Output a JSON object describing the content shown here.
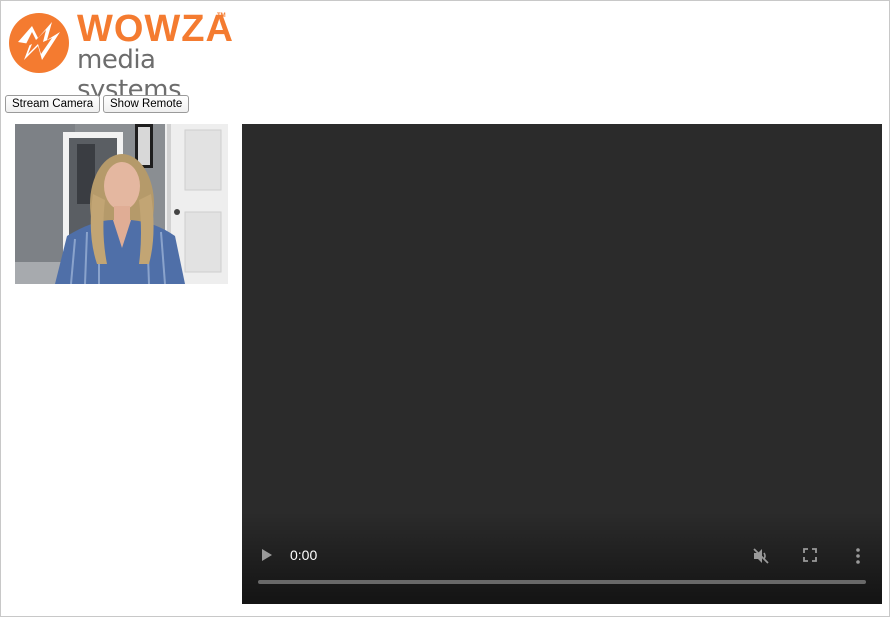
{
  "brand": {
    "logo_word": "WOWZA",
    "logo_tm": "TM",
    "logo_sub": "media systems",
    "accent_color": "#f47b30"
  },
  "controls": {
    "stream_camera_label": "Stream Camera",
    "show_remote_label": "Show Remote"
  },
  "local_video": {
    "icon": "camera-feed"
  },
  "player": {
    "time": "0:00",
    "progress": 0,
    "muted": true,
    "icons": [
      "play-icon",
      "muted-speaker-icon",
      "fullscreen-icon",
      "more-options-icon"
    ]
  }
}
